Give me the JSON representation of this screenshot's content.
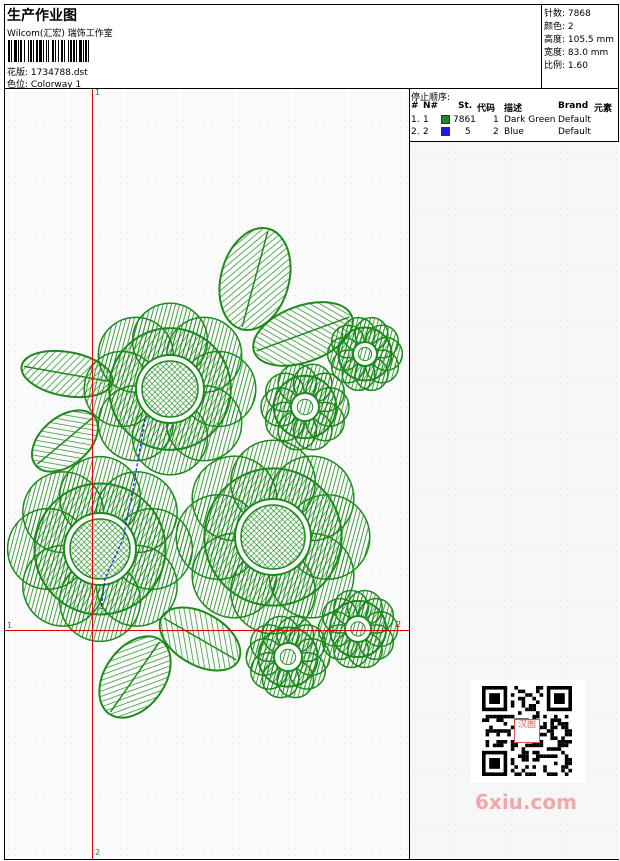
{
  "header": {
    "title": "生产作业图",
    "subtitle": "Wilcom(汇宏) 瑞饰工作室",
    "design_file": "花版: 1734788.dst",
    "colorway": "色位: Colorway 1"
  },
  "stats": {
    "stitches": "针数: 7868",
    "colors": "颜色: 2",
    "height": "高度: 105.5 mm",
    "width": "宽度: 83.0 mm",
    "scale": "比例: 1.60"
  },
  "stop_sequence": {
    "title": "停止顺序:",
    "columns": [
      "#",
      "N#",
      "St.",
      "代码",
      "描述",
      "Brand",
      "元素"
    ],
    "rows": [
      {
        "num": "1.",
        "n": "1",
        "swatch_color": "#1e8a1e",
        "stitches": "7861",
        "code": "1",
        "description": "Dark Green",
        "brand": "Default"
      },
      {
        "num": "2.",
        "n": "2",
        "swatch_color": "#1a1ae6",
        "stitches": "5",
        "code": "2",
        "description": "Blue",
        "brand": "Default"
      }
    ]
  },
  "axis_labels": {
    "v_top": "1",
    "v_bottom": "2",
    "h_left": "1",
    "h_right": "2"
  },
  "colors": {
    "thread_green": "#1e8a1e",
    "thread_blue": "#1a1ae6",
    "axis_red": "#e00000"
  },
  "watermark": "6xiu.com",
  "qr_center_text": "汉图"
}
